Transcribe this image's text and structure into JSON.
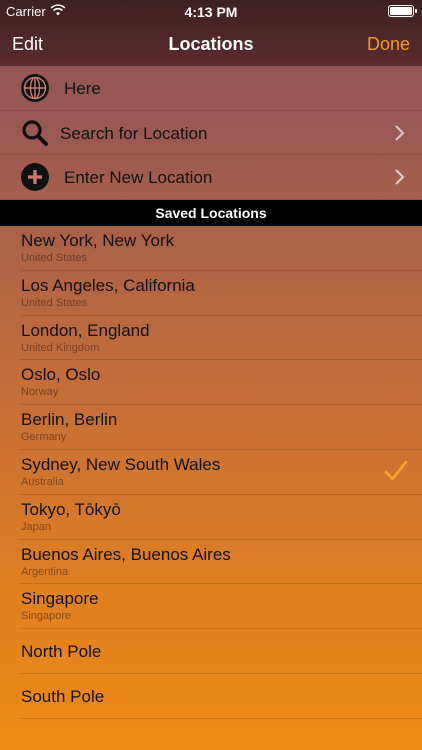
{
  "status": {
    "carrier": "Carrier",
    "time": "4:13 PM"
  },
  "nav": {
    "edit": "Edit",
    "title": "Locations",
    "done": "Done"
  },
  "actions": [
    {
      "label": "Here",
      "icon": "globe-icon"
    },
    {
      "label": "Search for Location",
      "icon": "search-icon"
    },
    {
      "label": "Enter New Location",
      "icon": "add-icon"
    }
  ],
  "section_header": "Saved Locations",
  "locations": [
    {
      "city": "New York, New York",
      "country": "United States",
      "selected": false
    },
    {
      "city": "Los Angeles, California",
      "country": "United States",
      "selected": false
    },
    {
      "city": "London, England",
      "country": "United Kingdom",
      "selected": false
    },
    {
      "city": "Oslo, Oslo",
      "country": "Norway",
      "selected": false
    },
    {
      "city": "Berlin, Berlin",
      "country": "Germany",
      "selected": false
    },
    {
      "city": "Sydney, New South Wales",
      "country": "Australia",
      "selected": true
    },
    {
      "city": "Tokyo, Tōkyō",
      "country": "Japan",
      "selected": false
    },
    {
      "city": "Buenos Aires, Buenos Aires",
      "country": "Argentina",
      "selected": false
    },
    {
      "city": "Singapore",
      "country": "Singapore",
      "selected": false
    },
    {
      "city": "North Pole",
      "country": "",
      "selected": false
    },
    {
      "city": "South Pole",
      "country": "",
      "selected": false
    }
  ],
  "colors": {
    "accent": "#f59a2a",
    "check": "#f5a623",
    "nav_bg": "#4a2528"
  }
}
